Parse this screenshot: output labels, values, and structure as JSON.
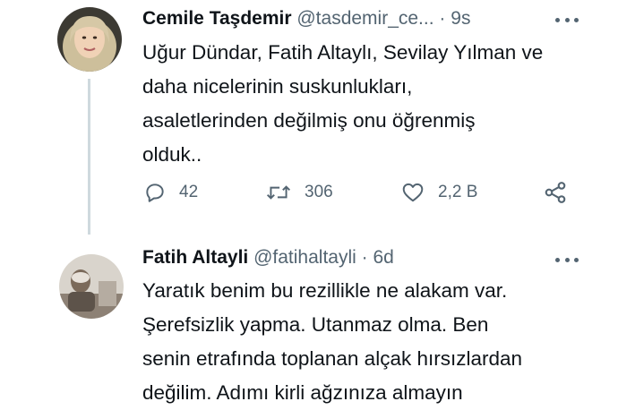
{
  "tweets": [
    {
      "name": "Cemile Taşdemir",
      "handle": "@tasdemir_ce...",
      "separator": "·",
      "time": "9s",
      "lines": [
        "Uğur Dündar, Fatih Altaylı, Sevilay Yılman ve",
        "daha nicelerinin suskunlukları,",
        "asaletlerinden değilmiş onu öğrenmiş",
        "olduk.."
      ],
      "actions": {
        "reply_icon": "reply-icon",
        "replies": "42",
        "retweet_icon": "retweet-icon",
        "retweets": "306",
        "like_icon": "heart-icon",
        "likes": "2,2 B",
        "share_icon": "share-icon"
      }
    },
    {
      "name": "Fatih Altayli",
      "handle": "@fatihaltayli",
      "separator": "·",
      "time": "6d",
      "lines": [
        "Yaratık benim bu rezillikle ne alakam var.",
        "Şerefsizlik yapma. Utanmaz olma. Ben",
        "senin etrafında toplanan alçak hırsızlardan",
        "değilim. Adımı kirli ağzınıza almayın"
      ]
    }
  ],
  "colors": {
    "text": "#0f1419",
    "secondary": "#536471",
    "thread_line": "#cfd9de"
  }
}
